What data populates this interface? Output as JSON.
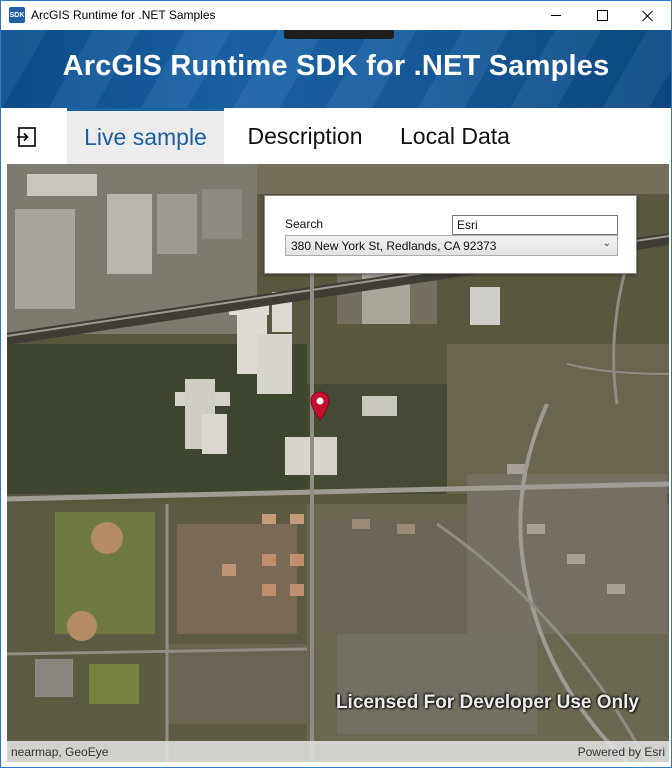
{
  "window": {
    "title": "ArcGIS Runtime for .NET Samples",
    "app_icon_text": "SDK"
  },
  "header": {
    "title": "ArcGIS Runtime SDK for .NET Samples"
  },
  "tabs": {
    "live": "Live sample",
    "description": "Description",
    "local_data": "Local Data"
  },
  "search": {
    "label": "Search",
    "input_value": "Esri",
    "selected_suggestion": "380 New York St, Redlands, CA 92373"
  },
  "map": {
    "watermark": "Licensed For Developer Use Only",
    "attribution_left": "nearmap, GeoEye",
    "attribution_right": "Powered by Esri",
    "marker_icon": "map-pin-icon",
    "marker_color": "#c8102e"
  },
  "colors": {
    "accent": "#1a5fa0",
    "header_bg": "#175d9f"
  }
}
